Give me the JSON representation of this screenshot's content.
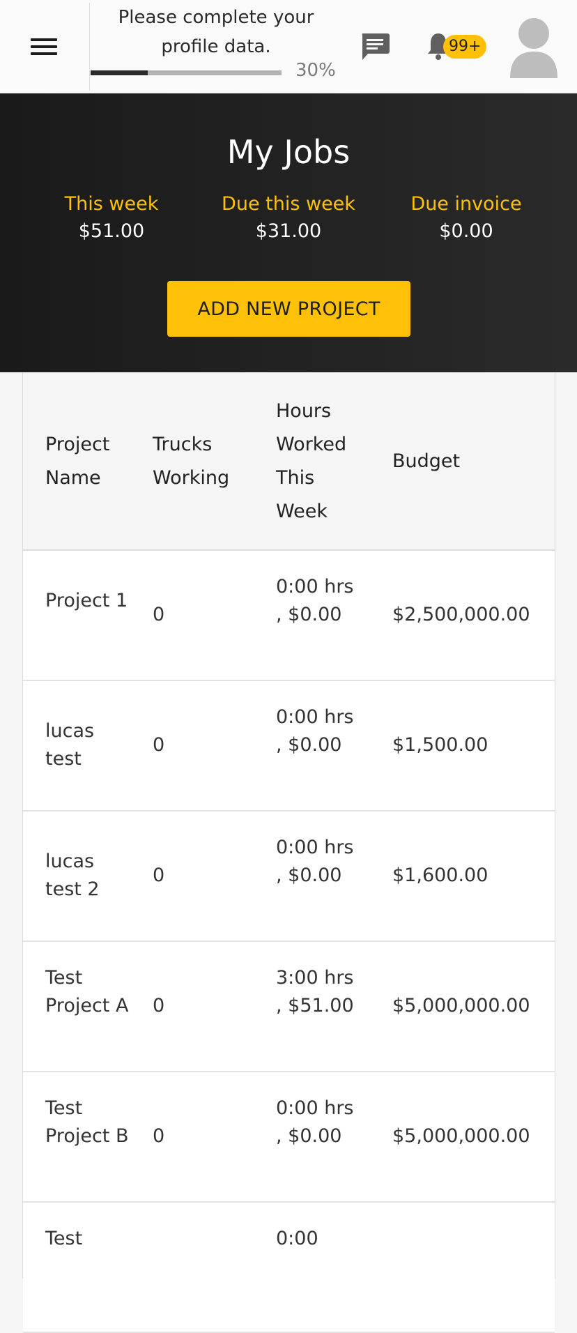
{
  "header": {
    "profile_message": "Please complete your profile data.",
    "profile_progress_label": "30%",
    "profile_progress": 0.3,
    "notification_count": "99+"
  },
  "hero": {
    "title": "My Jobs",
    "stats": [
      {
        "label": "This week",
        "value": "$51.00"
      },
      {
        "label": "Due this week",
        "value": "$31.00"
      },
      {
        "label": "Due invoice",
        "value": "$0.00"
      }
    ],
    "add_button_label": "ADD NEW PROJECT"
  },
  "table": {
    "columns": [
      "Project Name",
      "Trucks Working",
      "Hours Worked This Week",
      "Budget"
    ],
    "rows": [
      {
        "name": "Project 1",
        "trucks": "0",
        "hours": "0:00 hrs , $0.00",
        "budget": "$2,500,000.00"
      },
      {
        "name": "lucas test",
        "trucks": "0",
        "hours": "0:00 hrs , $0.00",
        "budget": "$1,500.00"
      },
      {
        "name": "lucas test 2",
        "trucks": "0",
        "hours": "0:00 hrs , $0.00",
        "budget": "$1,600.00"
      },
      {
        "name": "Test Project A",
        "trucks": "0",
        "hours": "3:00 hrs , $51.00",
        "budget": "$5,000,000.00"
      },
      {
        "name": "Test Project B",
        "trucks": "0",
        "hours": "0:00 hrs , $0.00",
        "budget": "$5,000,000.00"
      },
      {
        "name": "Test",
        "trucks": "",
        "hours": "0:00",
        "budget": ""
      }
    ]
  },
  "colors": {
    "accent": "#ffc107",
    "header_dark": "#1f1f1f"
  },
  "icons": [
    "hamburger-menu-icon",
    "chat-icon",
    "bell-icon",
    "avatar-icon"
  ]
}
